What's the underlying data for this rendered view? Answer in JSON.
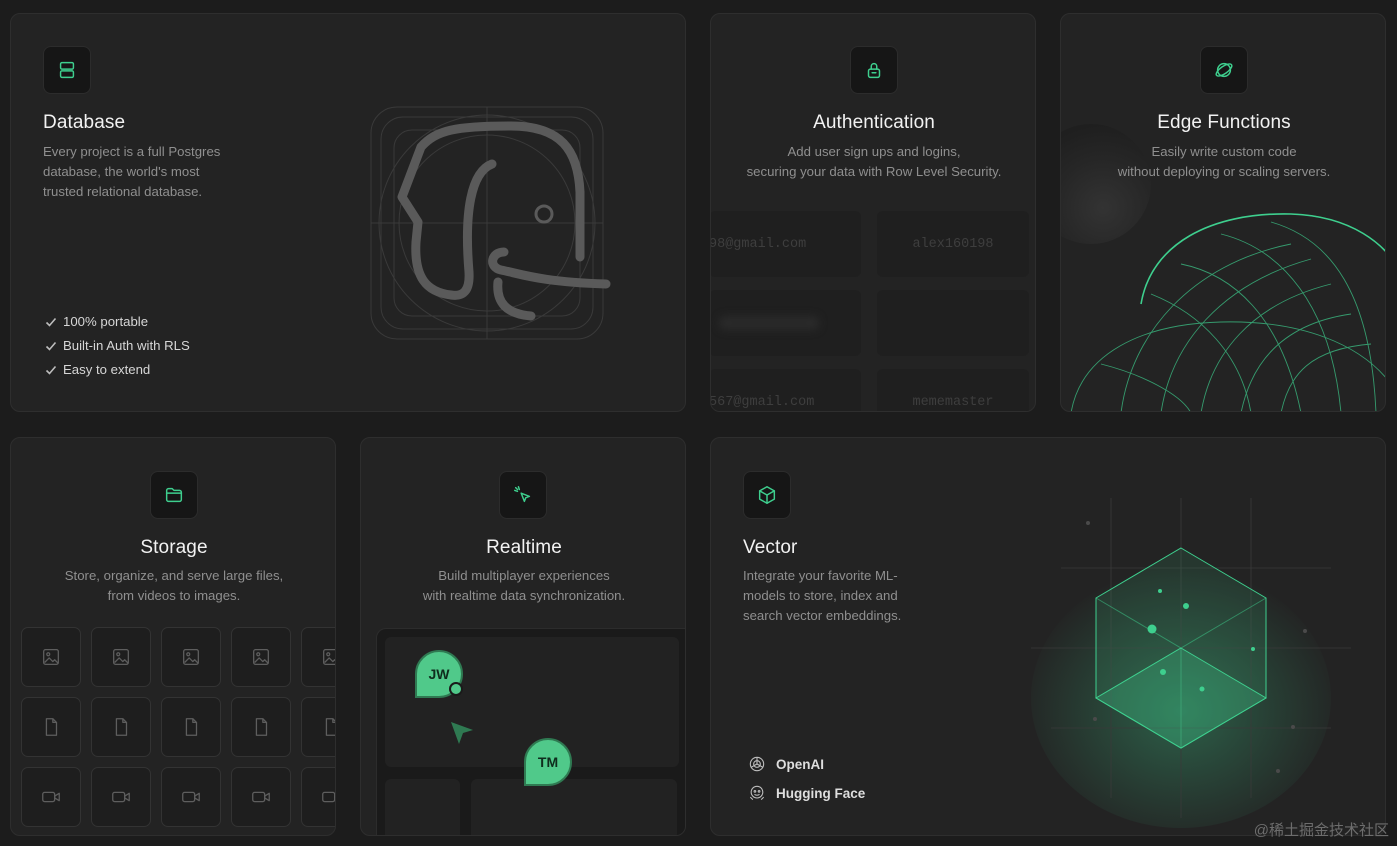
{
  "colors": {
    "accent": "#3ecf8e",
    "card_bg": "#232323",
    "page_bg": "#1c1c1c"
  },
  "database": {
    "icon": "database-icon",
    "title": "Database",
    "description_lines": [
      "Every project is a full Postgres",
      "database, the world's most",
      "trusted relational database."
    ],
    "features": [
      "100% portable",
      "Built-in Auth with RLS",
      "Easy to extend"
    ]
  },
  "authentication": {
    "icon": "lock-icon",
    "title": "Authentication",
    "description_lines": [
      "Add user sign ups and logins,",
      "securing your data with Row Level Security."
    ],
    "cells": [
      "98@gmail.com",
      "alex160198",
      "567@gmail.com",
      "mememaster"
    ]
  },
  "edge_functions": {
    "icon": "globe-icon",
    "title": "Edge Functions",
    "description_lines": [
      "Easily write custom code",
      "without deploying or scaling servers."
    ]
  },
  "storage": {
    "icon": "folder-icon",
    "title": "Storage",
    "description_lines": [
      "Store, organize, and serve large files,",
      "from videos to images."
    ]
  },
  "realtime": {
    "icon": "cursor-click-icon",
    "title": "Realtime",
    "description_lines": [
      "Build multiplayer experiences",
      "with realtime data synchronization."
    ],
    "avatars": [
      "JW",
      "TM"
    ]
  },
  "vector": {
    "icon": "cube-icon",
    "title": "Vector",
    "description_lines": [
      "Integrate your favorite ML-",
      "models to store, index and",
      "search vector embeddings."
    ],
    "integrations": [
      {
        "name": "OpenAI",
        "icon": "openai-icon"
      },
      {
        "name": "Hugging Face",
        "icon": "hugging-face-icon"
      }
    ]
  },
  "watermark": "@稀土掘金技术社区"
}
